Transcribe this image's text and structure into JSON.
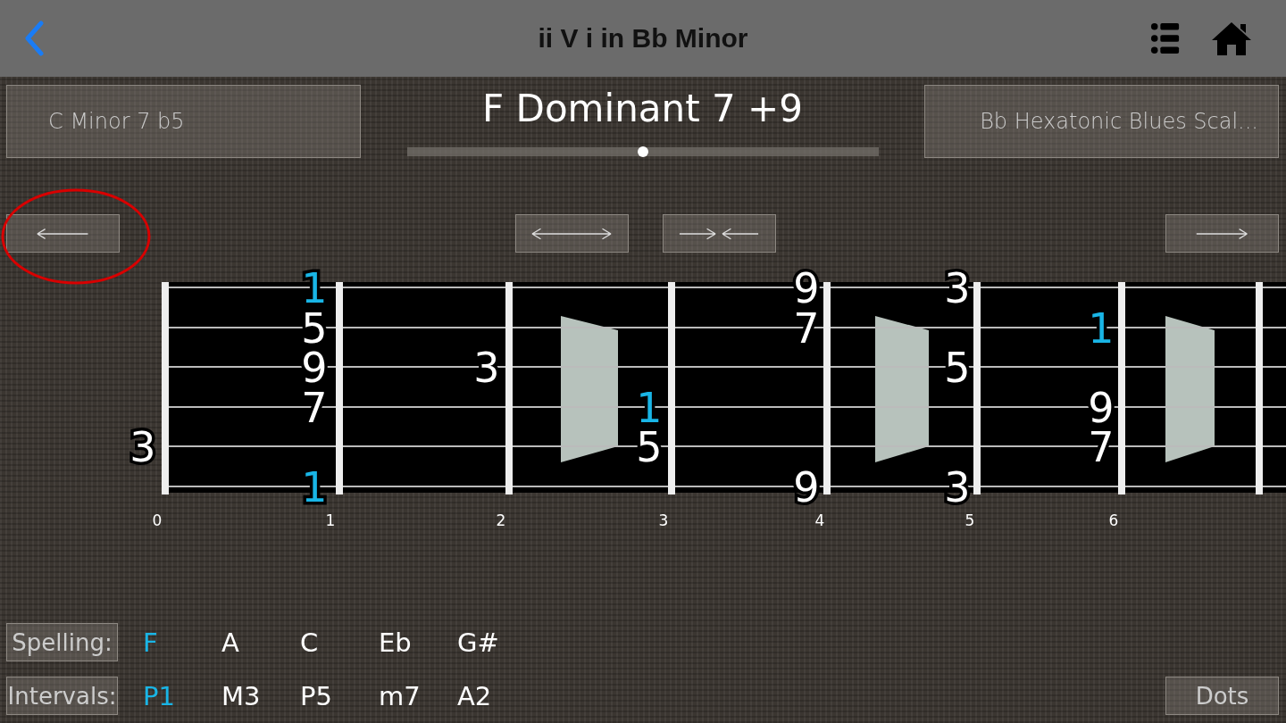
{
  "nav": {
    "title": "ii V i in Bb Minor"
  },
  "chords": {
    "previous": "C  Minor 7 b5",
    "current": "F  Dominant 7 +9",
    "next": "Bb Hexatonic Blues Scal...",
    "position": {
      "level": 0.5
    }
  },
  "fretboard": {
    "strings": [
      {
        "cells": [
          null,
          {
            "label": "1",
            "root": true
          },
          null,
          null,
          {
            "label": "9",
            "root": false
          },
          {
            "label": "3",
            "root": false
          },
          null
        ]
      },
      {
        "cells": [
          null,
          {
            "label": "5",
            "root": false
          },
          null,
          null,
          {
            "label": "7",
            "root": false
          },
          null,
          {
            "label": "1",
            "root": true
          }
        ]
      },
      {
        "cells": [
          null,
          {
            "label": "9",
            "root": false
          },
          {
            "label": "3",
            "root": false
          },
          null,
          null,
          {
            "label": "5",
            "root": false
          },
          null
        ]
      },
      {
        "cells": [
          null,
          {
            "label": "7",
            "root": false
          },
          null,
          {
            "label": "1",
            "root": true
          },
          null,
          null,
          {
            "label": "9",
            "root": false
          }
        ]
      },
      {
        "cells": [
          {
            "label": "3",
            "root": false
          },
          null,
          null,
          {
            "label": "5",
            "root": false
          },
          null,
          null,
          {
            "label": "7",
            "root": false
          }
        ]
      },
      {
        "cells": [
          null,
          {
            "label": "1",
            "root": true
          },
          null,
          null,
          {
            "label": "9",
            "root": false
          },
          {
            "label": "3",
            "root": false
          },
          null
        ]
      }
    ],
    "fret_numbers": [
      "0",
      "1",
      "2",
      "3",
      "4",
      "5",
      "6"
    ]
  },
  "spelling": {
    "label": "Spelling:",
    "notes": [
      {
        "text": "F",
        "root": true
      },
      {
        "text": "A",
        "root": false
      },
      {
        "text": "C",
        "root": false
      },
      {
        "text": "Eb",
        "root": false
      },
      {
        "text": "G#",
        "root": false
      }
    ]
  },
  "intervals": {
    "label": "Intervals:",
    "items": [
      {
        "text": "P1",
        "root": true
      },
      {
        "text": "M3",
        "root": false
      },
      {
        "text": "P5",
        "root": false
      },
      {
        "text": "m7",
        "root": false
      },
      {
        "text": "A2",
        "root": false
      }
    ]
  },
  "dots_button": "Dots"
}
